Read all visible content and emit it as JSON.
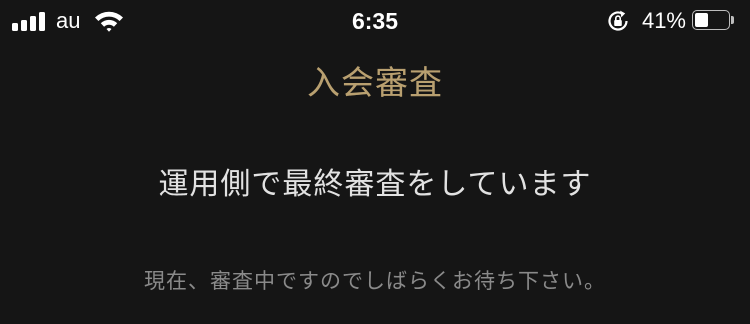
{
  "status_bar": {
    "carrier": "au",
    "time": "6:35",
    "battery_percent_text": "41%",
    "battery_level": 0.41,
    "signal_bars": 4,
    "icons": {
      "signal": "cellular-signal-icon",
      "wifi": "wifi-icon",
      "orientation_lock": "orientation-lock-icon",
      "battery": "battery-icon"
    }
  },
  "screen": {
    "title": "入会審査",
    "message": "運用側で最終審査をしています",
    "sub_message": "現在、審査中ですのでしばらくお待ち下さい。"
  },
  "colors": {
    "background": "#151515",
    "title": "#b9a070",
    "message": "#e2e2e2",
    "sub_message": "#8a8a8a",
    "status_text": "#ffffff"
  }
}
